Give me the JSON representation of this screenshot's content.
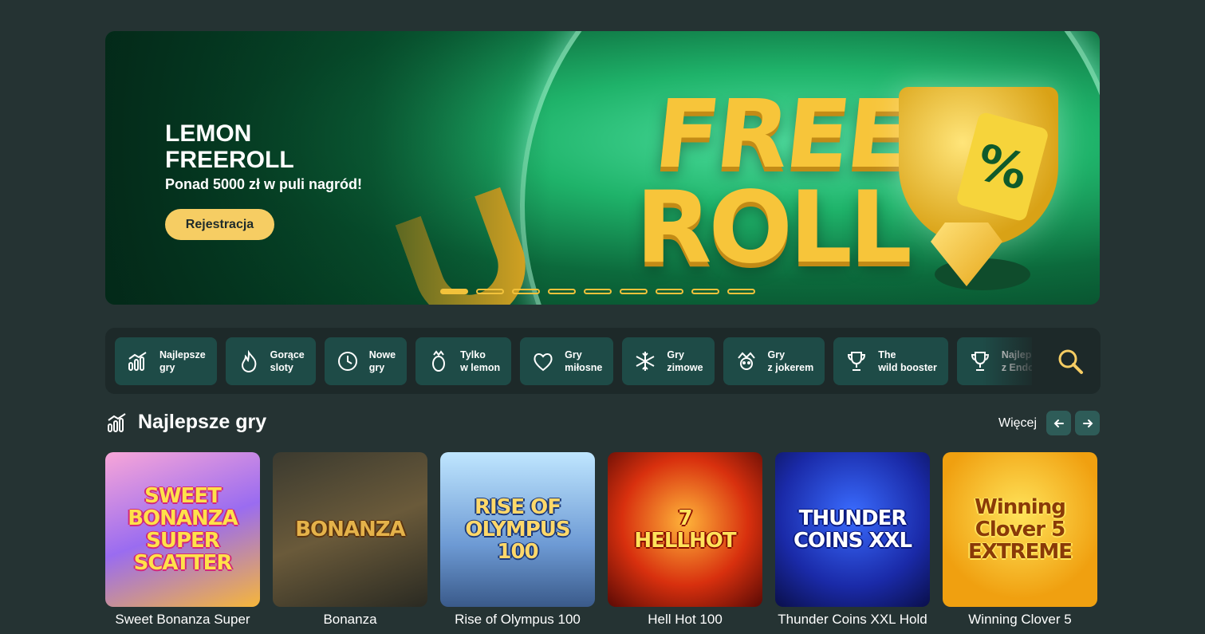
{
  "banner": {
    "title_line1": "LEMON",
    "title_line2": "FREEROLL",
    "subtitle": "Ponad 5000 zł w puli nagród!",
    "cta": "Rejestracja",
    "art_word1": "FREE",
    "art_word2": "ROLL",
    "art_tag": "%",
    "slides": 9,
    "active_slide": 1
  },
  "categories": [
    {
      "label": "Najlepsze\ngry",
      "icon": "bar-chart-icon"
    },
    {
      "label": "Gorące\nsloty",
      "icon": "flame-icon"
    },
    {
      "label": "Nowe\ngry",
      "icon": "clock-icon"
    },
    {
      "label": "Tylko\nw lemon",
      "icon": "lemon-crown-icon"
    },
    {
      "label": "Gry\nmiłosne",
      "icon": "heart-icon"
    },
    {
      "label": "Gry\nzimowe",
      "icon": "snowflake-icon"
    },
    {
      "label": "Gry\nz jokerem",
      "icon": "joker-icon"
    },
    {
      "label": "The\nwild booster",
      "icon": "trophy-icon"
    },
    {
      "label": "Najlepsze\nz Endorphina",
      "icon": "trophy-icon"
    }
  ],
  "section": {
    "title": "Najlepsze gry",
    "more": "Więcej"
  },
  "games": [
    {
      "name": "Sweet Bonanza Super",
      "art": "SWEET\nBONANZA\nSUPER\nSCATTER"
    },
    {
      "name": "Bonanza",
      "art": "BONANZA"
    },
    {
      "name": "Rise of Olympus 100",
      "art": "RISE OF\nOLYMPUS\n100"
    },
    {
      "name": "Hell Hot 100",
      "art": "7\nHELLHOT"
    },
    {
      "name": "Thunder Coins XXL Hold",
      "art": "THUNDER\nCOINS XXL"
    },
    {
      "name": "Winning Clover 5",
      "art": "Winning\nClover 5\nEXTREME"
    }
  ],
  "colors": {
    "background": "#253333",
    "accent": "#f6cd63",
    "category_bg": "#1e4b47"
  }
}
